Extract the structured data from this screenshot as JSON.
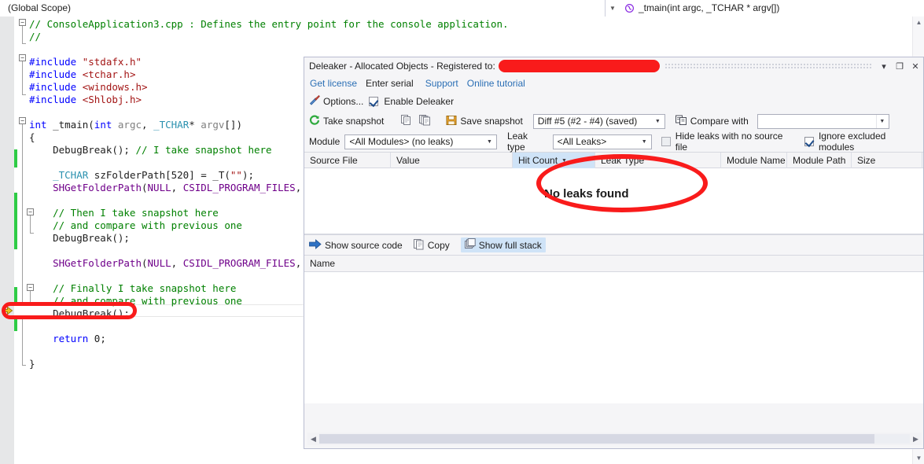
{
  "ide": {
    "scope_selector": "(Global Scope)",
    "function_selector": "_tmain(int argc, _TCHAR * argv[])"
  },
  "code": {
    "lines": [
      "// ConsoleApplication3.cpp : Defines the entry point for the console application.",
      "//",
      "",
      "#include \"stdafx.h\"",
      "#include <tchar.h>",
      "#include <windows.h>",
      "#include <Shlobj.h>",
      "",
      "int _tmain(int argc, _TCHAR* argv[])",
      "{",
      "    DebugBreak(); // I take snapshot here",
      "",
      "    _TCHAR szFolderPath[520] = _T(\"\");",
      "    SHGetFolderPath(NULL, CSIDL_PROGRAM_FILES, NUL",
      "",
      "    // Then I take snapshot here",
      "    // and compare with previous one",
      "    DebugBreak();",
      "",
      "    SHGetFolderPath(NULL, CSIDL_PROGRAM_FILES, NUL",
      "",
      "    // Finally I take snapshot here",
      "    // and compare with previous one",
      "    DebugBreak();",
      "",
      "    return 0;",
      "}"
    ]
  },
  "deleaker": {
    "title": "Deleaker - Allocated Objects - Registered to:",
    "title_redacted": "",
    "window_buttons": {
      "dropdown": "▾",
      "maximize": "❐",
      "close": "✕"
    },
    "links": {
      "get_license": "Get license",
      "enter_serial": "Enter serial",
      "support": "Support",
      "online_tutorial": "Online tutorial"
    },
    "toolbar": {
      "options": "Options...",
      "enable_deleaker": "Enable Deleaker",
      "enable_deleaker_checked": true,
      "take_snapshot": "Take snapshot",
      "save_snapshot": "Save snapshot",
      "snapshot_value": "Diff #5 (#2 - #4) (saved)",
      "compare_with": "Compare with",
      "compare_with_value": ""
    },
    "filters": {
      "module_label": "Module",
      "module_value": "<All Modules> (no leaks)",
      "leak_type_label": "Leak type",
      "leak_type_value": "<All Leaks>",
      "hide_leaks_no_source": "Hide leaks with no source file",
      "hide_leaks_no_source_checked": false,
      "ignore_excluded_modules": "Ignore excluded modules",
      "ignore_excluded_modules_checked": true
    },
    "grid": {
      "columns": [
        {
          "label": "Source File",
          "width": 110,
          "sorted": false
        },
        {
          "label": "Value",
          "width": 155,
          "sorted": false
        },
        {
          "label": "Hit Count",
          "width": 105,
          "sorted": true
        },
        {
          "label": "Leak Type",
          "width": 160,
          "sorted": false
        },
        {
          "label": "Module Name",
          "width": 84,
          "sorted": false
        },
        {
          "label": "Module Path",
          "width": 82,
          "sorted": false
        },
        {
          "label": "Size",
          "width": 90,
          "sorted": false
        }
      ],
      "empty_message": "No leaks found"
    },
    "stack_toolbar": {
      "show_source_code": "Show source code",
      "copy": "Copy",
      "show_full_stack": "Show full stack",
      "show_full_stack_selected": true
    },
    "stack_grid": {
      "name_column": "Name"
    }
  },
  "colors": {
    "annotation_red": "#f91b1b",
    "selection_blue": "#cfe3f7",
    "comment_green": "#008000",
    "keyword_blue": "#0000ff",
    "macro_purple": "#6f008a",
    "string_red": "#a31515",
    "changebar_green": "#2ecc45",
    "link_blue": "#2b6fb5"
  }
}
